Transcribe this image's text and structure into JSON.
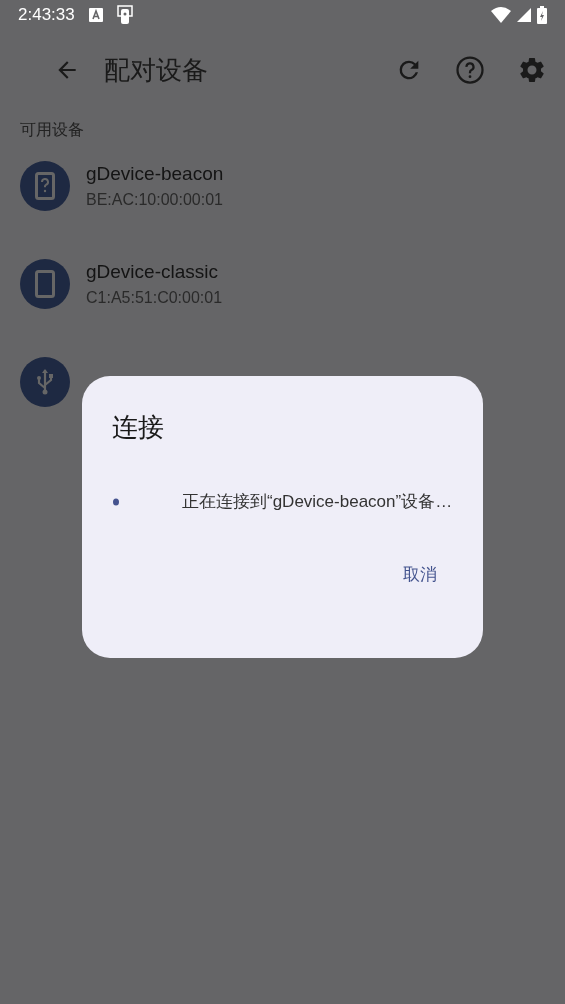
{
  "status_bar": {
    "time": "2:43:33"
  },
  "app_bar": {
    "title": "配对设备"
  },
  "section_header": "可用设备",
  "devices": [
    {
      "kind": "unknown",
      "name": "gDevice-beacon",
      "address": "BE:AC:10:00:00:01"
    },
    {
      "kind": "phone",
      "name": "gDevice-classic",
      "address": "C1:A5:51:C0:00:01"
    },
    {
      "kind": "usb"
    }
  ],
  "dialog": {
    "title": "连接",
    "message": "正在连接到“gDevice-beacon”设备…",
    "buttons": [
      "取消"
    ]
  }
}
